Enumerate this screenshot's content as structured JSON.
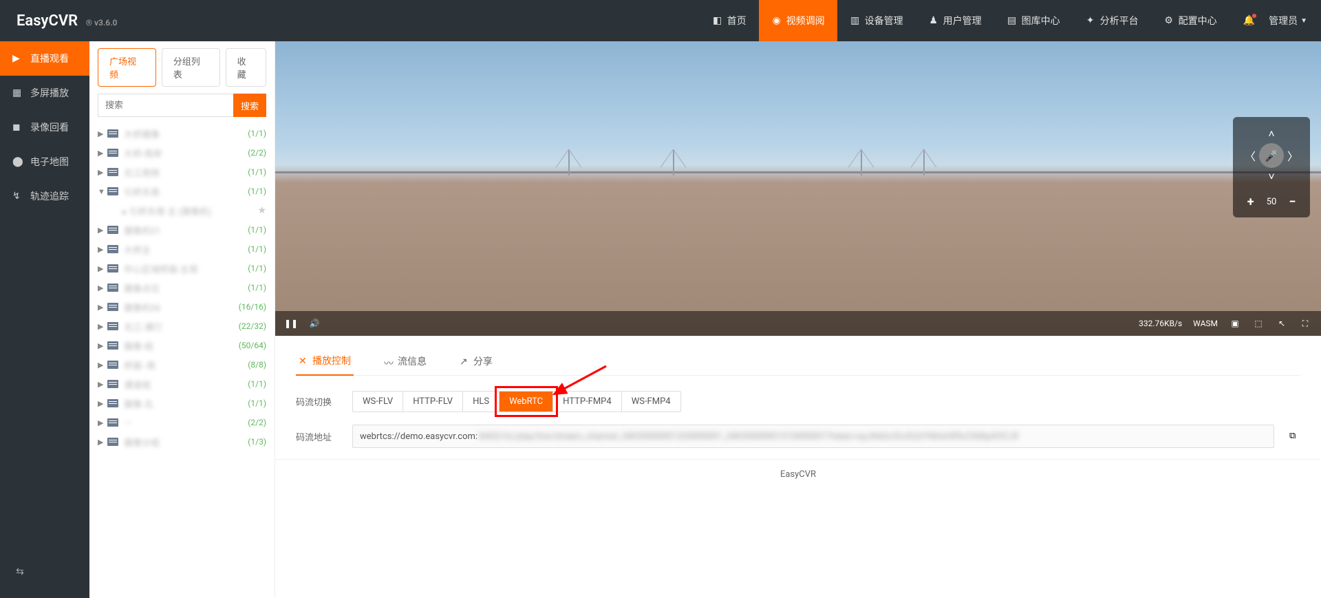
{
  "header": {
    "logo": "EasyCVR",
    "version": "® v3.6.0",
    "nav": [
      {
        "label": "首页",
        "active": false
      },
      {
        "label": "视频调阅",
        "active": true
      },
      {
        "label": "设备管理",
        "active": false
      },
      {
        "label": "用户管理",
        "active": false
      },
      {
        "label": "图库中心",
        "active": false
      },
      {
        "label": "分析平台",
        "active": false
      },
      {
        "label": "配置中心",
        "active": false
      }
    ],
    "user": "管理员"
  },
  "sidebar": [
    {
      "label": "直播观看",
      "active": true
    },
    {
      "label": "多屏播放",
      "active": false
    },
    {
      "label": "录像回看",
      "active": false
    },
    {
      "label": "电子地图",
      "active": false
    },
    {
      "label": "轨迹追踪",
      "active": false
    }
  ],
  "tree": {
    "tabs": [
      {
        "label": "广场视频",
        "active": true
      },
      {
        "label": "分组列表",
        "active": false
      },
      {
        "label": "收藏",
        "active": false
      }
    ],
    "search_placeholder": "搜索",
    "search_btn": "搜索",
    "items": [
      {
        "blur": "大桥摄像",
        "count": "(1/1)",
        "caret": "▶"
      },
      {
        "blur": "大桥-南岸",
        "count": "(2/2)",
        "caret": "▶"
      },
      {
        "blur": "北江南侧",
        "count": "(1/1)",
        "caret": "▶"
      },
      {
        "blur": "引桥东南",
        "count": "(1/1)",
        "caret": "▼",
        "child": true
      },
      {
        "blur": "摄像机01",
        "count": "(1/1)",
        "caret": "▶"
      },
      {
        "blur": "大桥主",
        "count": "(1/1)",
        "caret": "▶"
      },
      {
        "blur": "中心区域桥面-主视",
        "count": "(1/1)",
        "caret": "▶"
      },
      {
        "blur": "摄像点位",
        "count": "(1/1)",
        "caret": "▶"
      },
      {
        "blur": "摄像机06",
        "count": "(16/16)",
        "caret": "▶"
      },
      {
        "blur": "北江-通行",
        "count": "(22/32)",
        "caret": "▶"
      },
      {
        "blur": "摄像-组",
        "count": "(50/64)",
        "caret": "▶"
      },
      {
        "blur": "桥面--南",
        "count": "(8/8)",
        "caret": "▶"
      },
      {
        "blur": "通道组",
        "count": "(1/1)",
        "caret": "▶"
      },
      {
        "blur": "摄像-北",
        "count": "(1/1)",
        "caret": "▶"
      },
      {
        "blur": "---",
        "count": "(2/2)",
        "caret": "▶"
      },
      {
        "blur": "摄像分组",
        "count": "(1/3)",
        "caret": "▶"
      }
    ]
  },
  "video": {
    "bitrate": "332.76KB/s",
    "decoder": "WASM"
  },
  "ptz": {
    "zoom": "50"
  },
  "under": {
    "tabs": [
      {
        "label": "播放控制",
        "active": true
      },
      {
        "label": "流信息",
        "active": false
      },
      {
        "label": "分享",
        "active": false
      }
    ],
    "stream_switch_label": "码流切换",
    "protocols": [
      {
        "label": "WS-FLV",
        "active": false
      },
      {
        "label": "HTTP-FLV",
        "active": false
      },
      {
        "label": "HLS",
        "active": false
      },
      {
        "label": "WebRTC",
        "active": true
      },
      {
        "label": "HTTP-FMP4",
        "active": false
      },
      {
        "label": "WS-FMP4",
        "active": false
      }
    ],
    "url_label": "码流地址",
    "url_prefix": "webrtcs://demo.easycvr.com:",
    "url_blur": "8443/rtc/play/live/stream_channel_34020000001320000001_34020000001310000001?token=eyJhbGciOiJIUzI1NiIsInR5cCI6IkpXVCJ9"
  },
  "footer": "EasyCVR"
}
